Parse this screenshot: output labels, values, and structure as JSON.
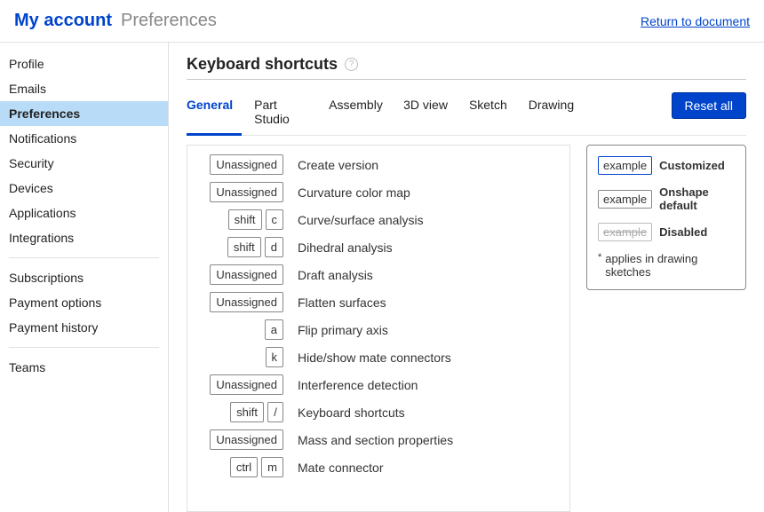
{
  "header": {
    "title_main": "My account",
    "title_sub": "Preferences",
    "return_link": "Return to document"
  },
  "sidebar": {
    "items": [
      {
        "label": "Profile",
        "active": false
      },
      {
        "label": "Emails",
        "active": false
      },
      {
        "label": "Preferences",
        "active": true
      },
      {
        "label": "Notifications",
        "active": false
      },
      {
        "label": "Security",
        "active": false
      },
      {
        "label": "Devices",
        "active": false
      },
      {
        "label": "Applications",
        "active": false
      },
      {
        "label": "Integrations",
        "active": false
      }
    ],
    "items2": [
      {
        "label": "Subscriptions"
      },
      {
        "label": "Payment options"
      },
      {
        "label": "Payment history"
      }
    ],
    "items3": [
      {
        "label": "Teams"
      }
    ]
  },
  "section": {
    "title": "Keyboard shortcuts",
    "help_glyph": "?"
  },
  "tabs": [
    {
      "label": "General",
      "active": true
    },
    {
      "label": "Part Studio"
    },
    {
      "label": "Assembly"
    },
    {
      "label": "3D view"
    },
    {
      "label": "Sketch"
    },
    {
      "label": "Drawing"
    }
  ],
  "reset_label": "Reset all",
  "shortcuts": [
    {
      "keys": [
        "Unassigned"
      ],
      "desc": "Create version"
    },
    {
      "keys": [
        "Unassigned"
      ],
      "desc": "Curvature color map"
    },
    {
      "keys": [
        "shift",
        "c"
      ],
      "desc": "Curve/surface analysis"
    },
    {
      "keys": [
        "shift",
        "d"
      ],
      "desc": "Dihedral analysis"
    },
    {
      "keys": [
        "Unassigned"
      ],
      "desc": "Draft analysis"
    },
    {
      "keys": [
        "Unassigned"
      ],
      "desc": "Flatten surfaces"
    },
    {
      "keys": [
        "a"
      ],
      "desc": "Flip primary axis"
    },
    {
      "keys": [
        "k"
      ],
      "desc": "Hide/show mate connectors"
    },
    {
      "keys": [
        "Unassigned"
      ],
      "desc": "Interference detection"
    },
    {
      "keys": [
        "shift",
        "/"
      ],
      "desc": "Keyboard shortcuts"
    },
    {
      "keys": [
        "Unassigned"
      ],
      "desc": "Mass and section properties"
    },
    {
      "keys": [
        "ctrl",
        "m"
      ],
      "desc": "Mate connector"
    }
  ],
  "legend": {
    "example_text": "example",
    "customized": "Customized",
    "default": "Onshape default",
    "disabled": "Disabled",
    "note_star": "*",
    "note": "applies in drawing sketches"
  }
}
